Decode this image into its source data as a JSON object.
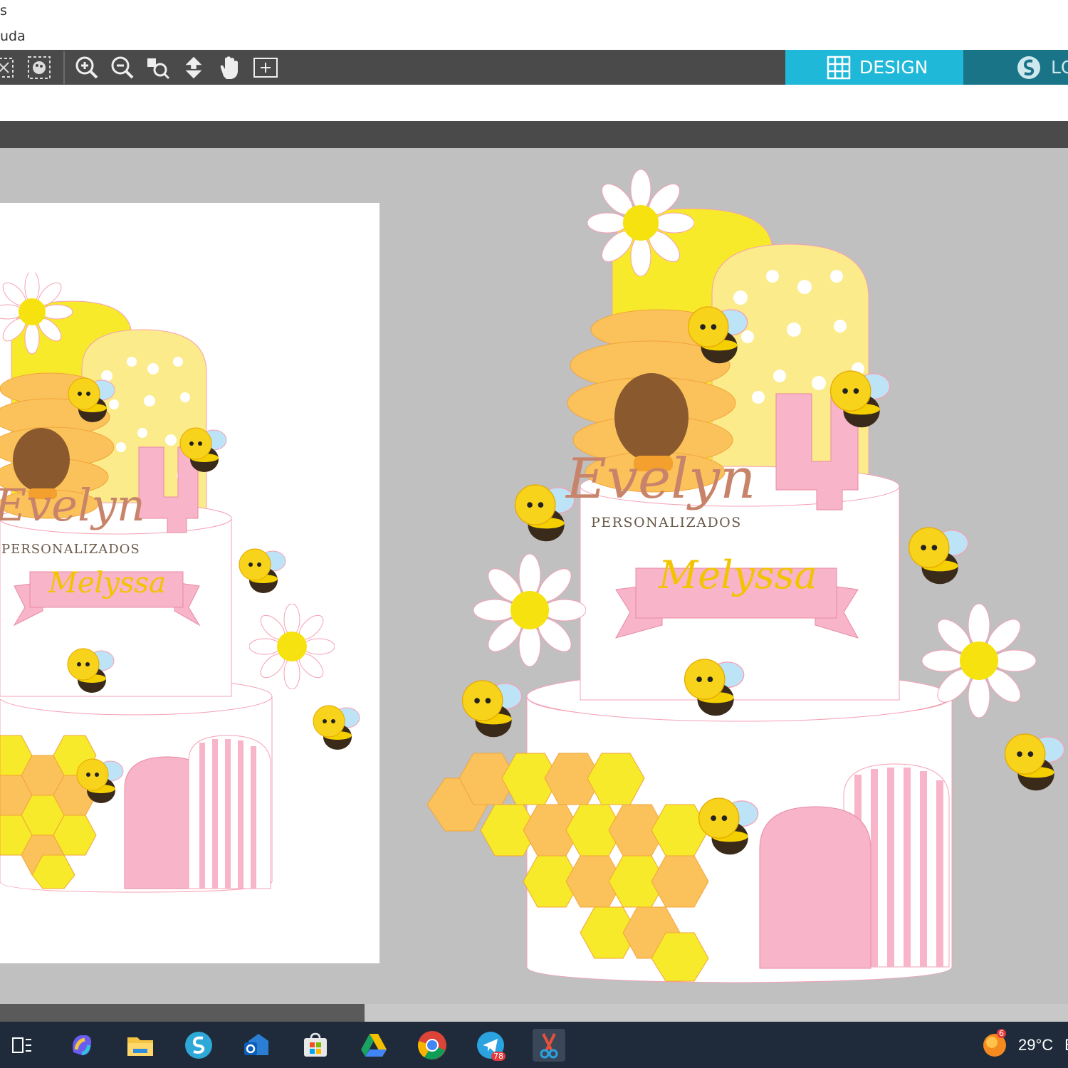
{
  "menu": {
    "fragment_1": "s",
    "fragment_2": "uda"
  },
  "toolbar": {
    "tools": [
      "deselect-icon",
      "select-all-icon",
      "zoom-in-icon",
      "zoom-out-icon",
      "zoom-selection-icon",
      "fit-page-icon",
      "pan-icon",
      "grid-view-icon"
    ]
  },
  "tabs": {
    "design": "DESIGN",
    "library": "LC"
  },
  "design": {
    "brand_name": "Evelyn",
    "brand_sub": "PERSONALIZADOS",
    "child_name": "Melyssa",
    "age_number": "4"
  },
  "taskbar": {
    "apps": [
      "task-view-icon",
      "copilot-icon",
      "file-explorer-icon",
      "silhouette-studio-icon",
      "outlook-icon",
      "microsoft-store-icon",
      "google-drive-icon",
      "chrome-icon",
      "telegram-icon",
      "snip-tool-icon"
    ],
    "telegram_badge": "78",
    "weather_badge": "6",
    "temperature": "29°C",
    "truncated": "E"
  },
  "colors": {
    "toolbar_bg": "#4a4a4a",
    "design_tab": "#1fb8d8",
    "library_tab": "#197488",
    "canvas_bg": "#c0c0c0",
    "honey_yellow": "#f7ea2a",
    "honey_orange": "#fbc25b",
    "pink": "#f8b4c8",
    "taskbar_bg": "#1f2b3b"
  }
}
